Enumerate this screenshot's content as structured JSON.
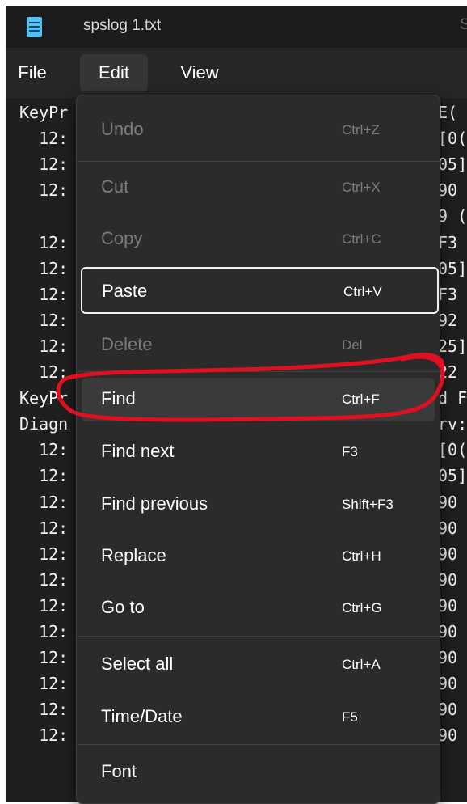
{
  "window": {
    "tab_title": "spslog 1.txt",
    "tab_next_glyph": "S"
  },
  "menubar": {
    "file": "File",
    "edit": "Edit",
    "view": "View"
  },
  "editor": {
    "left_lines": [
      "KeyPr",
      "  12:",
      "  12:",
      "  12:",
      "",
      "  12:",
      "  12:",
      "  12:",
      "  12:",
      "  12:",
      "  12:",
      "KeyPr",
      "Diagn",
      "  12:",
      "  12:",
      "  12:",
      "  12:",
      "  12:",
      "  12:",
      "  12:",
      "  12:",
      "  12:",
      "  12:",
      "  12:",
      "  12:"
    ],
    "right_lines": [
      "E(",
      "[0(",
      "05]",
      "90",
      "9 (",
      "F3",
      "05]",
      "F3",
      "92",
      "25]",
      "22",
      "d F",
      "rv:",
      "[0(",
      "05]",
      "90",
      "90",
      "90",
      "90",
      "90",
      "90",
      "90",
      "90",
      "90",
      "90"
    ]
  },
  "edit_menu": {
    "items": [
      {
        "label": "Undo",
        "shortcut": "Ctrl+Z",
        "state": "disabled"
      },
      {
        "label": "Cut",
        "shortcut": "Ctrl+X",
        "state": "disabled"
      },
      {
        "label": "Copy",
        "shortcut": "Ctrl+C",
        "state": "disabled"
      },
      {
        "label": "Paste",
        "shortcut": "Ctrl+V",
        "state": "focused"
      },
      {
        "label": "Delete",
        "shortcut": "Del",
        "state": "disabled"
      },
      {
        "label": "Find",
        "shortcut": "Ctrl+F",
        "state": "hover"
      },
      {
        "label": "Find next",
        "shortcut": "F3",
        "state": "enabled"
      },
      {
        "label": "Find previous",
        "shortcut": "Shift+F3",
        "state": "enabled"
      },
      {
        "label": "Replace",
        "shortcut": "Ctrl+H",
        "state": "enabled"
      },
      {
        "label": "Go to",
        "shortcut": "Ctrl+G",
        "state": "enabled"
      },
      {
        "label": "Select all",
        "shortcut": "Ctrl+A",
        "state": "enabled"
      },
      {
        "label": "Time/Date",
        "shortcut": "F5",
        "state": "enabled"
      },
      {
        "label": "Font",
        "shortcut": "",
        "state": "enabled"
      }
    ]
  },
  "colors": {
    "annotation_red": "#e01020",
    "menu_bg": "#2b2b2b",
    "editor_bg": "#1f1f1f",
    "disabled_text": "#7c7c7c",
    "file_icon": "#4fc3f7"
  },
  "icons": {
    "file_icon": "notepad-document-icon"
  }
}
